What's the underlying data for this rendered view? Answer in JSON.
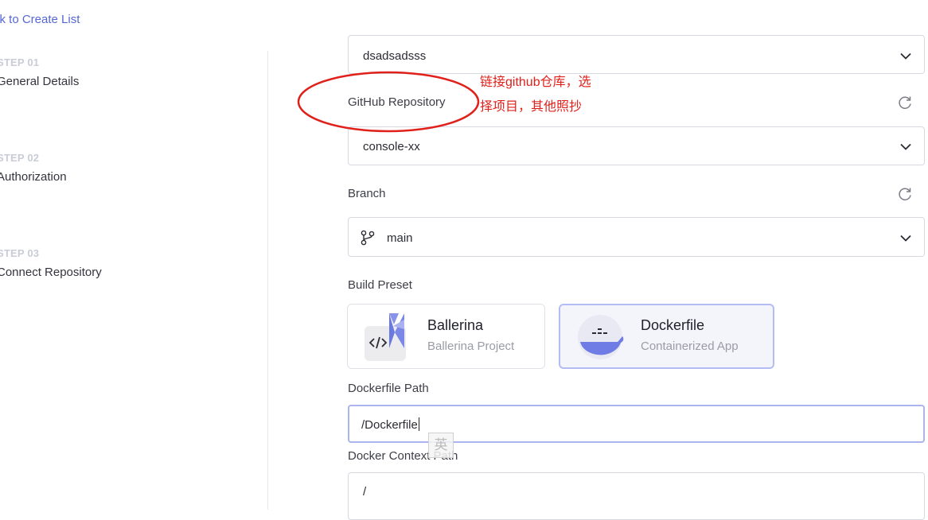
{
  "back_link": "ck to Create List",
  "steps": [
    {
      "num": "STEP 01",
      "name": "General Details"
    },
    {
      "num": "STEP 02",
      "name": "Authorization"
    },
    {
      "num": "STEP 03",
      "name": "Connect Repository"
    }
  ],
  "form": {
    "organization_value": "dsadsadsss",
    "repository": {
      "label": "GitHub Repository",
      "value": "console-xx"
    },
    "branch": {
      "label": "Branch",
      "value": "main"
    },
    "build_preset": {
      "label": "Build Preset",
      "options": [
        {
          "title": "Ballerina",
          "subtitle": "Ballerina Project",
          "selected": false
        },
        {
          "title": "Dockerfile",
          "subtitle": "Containerized App",
          "selected": true
        }
      ]
    },
    "dockerfile_path": {
      "label": "Dockerfile Path",
      "value": "/Dockerfile"
    },
    "docker_context_path": {
      "label": "Docker Context Path",
      "value": "/"
    }
  },
  "annotation": {
    "line1": "链接github仓库，选",
    "line2": "择项目，其他照抄",
    "color": "#e0201b"
  },
  "ime_indicator": "英",
  "colors": {
    "accent": "#5567d5",
    "selected_border": "#b4bdf3",
    "annotation": "#e0201b"
  }
}
